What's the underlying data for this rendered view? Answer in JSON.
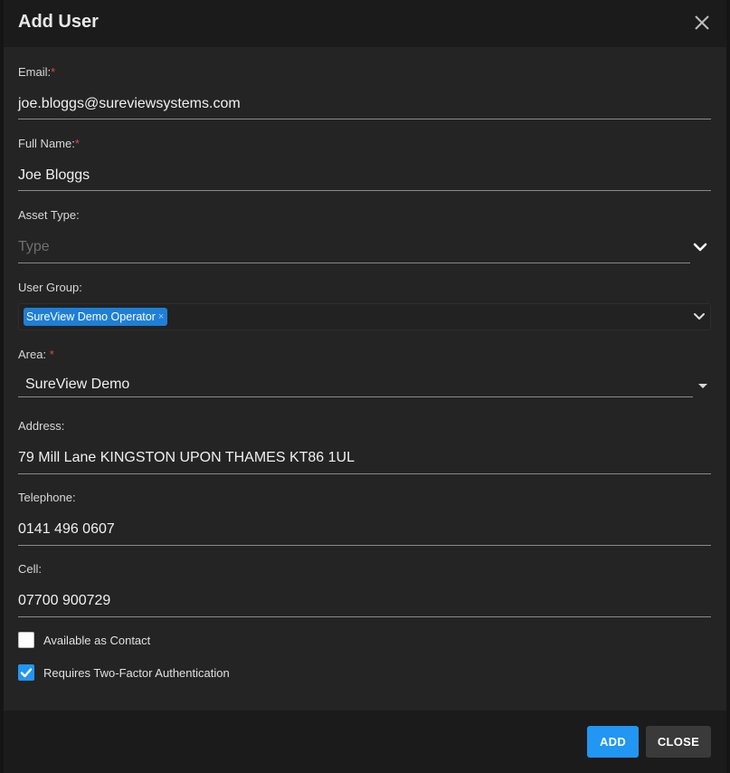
{
  "dialog": {
    "title": "Add User",
    "close_icon": "close-icon"
  },
  "form": {
    "email": {
      "label": "Email:",
      "required_mark": "*",
      "value": "joe.bloggs@sureviewsystems.com"
    },
    "full_name": {
      "label": "Full Name:",
      "required_mark": "*",
      "value": "Joe Bloggs"
    },
    "asset_type": {
      "label": "Asset Type:",
      "placeholder": "Type"
    },
    "user_group": {
      "label": "User Group:",
      "tags": [
        "SureView Demo Operator"
      ],
      "tag_remove": "×"
    },
    "area": {
      "label": "Area:",
      "required_mark": "*",
      "value": "SureView Demo"
    },
    "address": {
      "label": "Address:",
      "value": "79 Mill Lane KINGSTON UPON THAMES KT86 1UL"
    },
    "telephone": {
      "label": "Telephone:",
      "value": "0141 496 0607"
    },
    "cell": {
      "label": "Cell:",
      "value": "07700 900729"
    },
    "available_as_contact": {
      "label": "Available as Contact",
      "checked": false
    },
    "two_factor": {
      "label": "Requires Two-Factor Authentication",
      "checked": true
    }
  },
  "footer": {
    "add_label": "ADD",
    "close_label": "CLOSE"
  },
  "colors": {
    "accent": "#2196f3",
    "required": "#e04848",
    "background": "#242424",
    "header": "#1b1b1b"
  }
}
